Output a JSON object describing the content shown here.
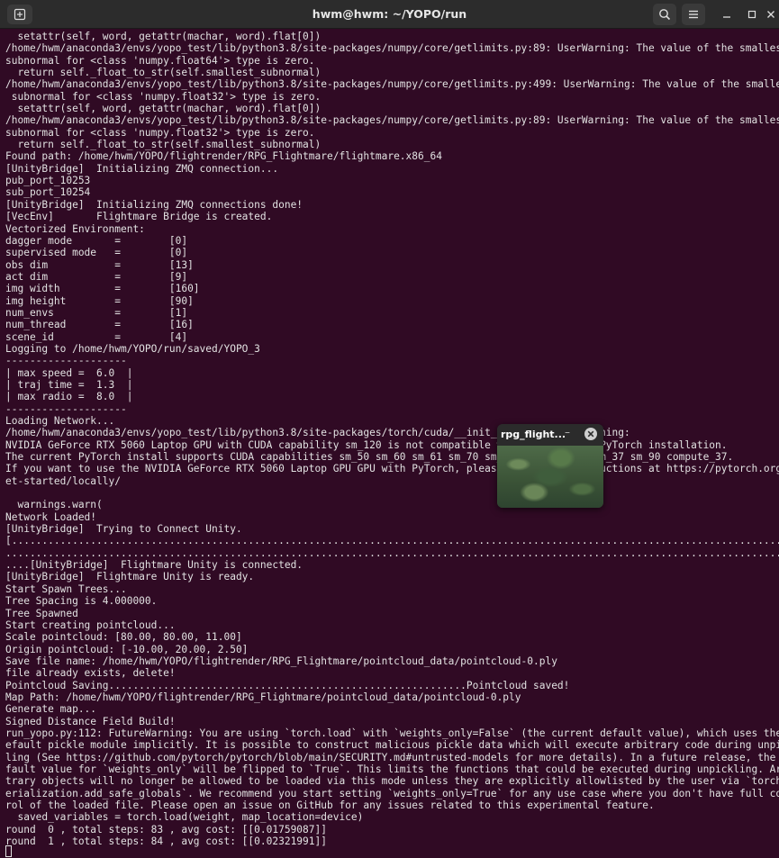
{
  "window": {
    "title": "hwm@hwm: ~/YOPO/run",
    "icons": {
      "new_tab": "new-tab-icon",
      "search": "search-icon",
      "menu": "hamburger-menu-icon",
      "minimize": "minimize-icon",
      "maximize": "maximize-icon",
      "close": "close-icon"
    }
  },
  "terminal": {
    "lines": [
      "  setattr(self, word, getattr(machar, word).flat[0])",
      "/home/hwm/anaconda3/envs/yopo_test/lib/python3.8/site-packages/numpy/core/getlimits.py:89: UserWarning: The value of the smallest",
      "subnormal for <class 'numpy.float64'> type is zero.",
      "  return self._float_to_str(self.smallest_subnormal)",
      "/home/hwm/anaconda3/envs/yopo_test/lib/python3.8/site-packages/numpy/core/getlimits.py:499: UserWarning: The value of the smalles",
      " subnormal for <class 'numpy.float32'> type is zero.",
      "  setattr(self, word, getattr(machar, word).flat[0])",
      "/home/hwm/anaconda3/envs/yopo_test/lib/python3.8/site-packages/numpy/core/getlimits.py:89: UserWarning: The value of the smallest",
      "subnormal for <class 'numpy.float32'> type is zero.",
      "  return self._float_to_str(self.smallest_subnormal)",
      "Found path: /home/hwm/YOPO/flightrender/RPG_Flightmare/flightmare.x86_64",
      "[UnityBridge]  Initializing ZMQ connection...",
      "pub_port_10253",
      "sub_port_10254",
      "[UnityBridge]  Initializing ZMQ connections done!",
      "[VecEnv]       Flightmare Bridge is created.",
      "Vectorized Environment:",
      "dagger mode       =        [0]",
      "supervised mode   =        [0]",
      "obs dim           =        [13]",
      "act dim           =        [9]",
      "img width         =        [160]",
      "img height        =        [90]",
      "num_envs          =        [1]",
      "num_thread        =        [16]",
      "scene_id          =        [4]",
      "Logging to /home/hwm/YOPO/run/saved/YOPO_3",
      "--------------------",
      "| max speed =  6.0  |",
      "| traj time =  1.3  |",
      "| max radio =  8.0  |",
      "--------------------",
      "Loading Network...",
      "/home/hwm/anaconda3/envs/yopo_test/lib/python3.8/site-packages/torch/cuda/__init__.py:230: UserWarning:",
      "NVIDIA GeForce RTX 5060 Laptop GPU with CUDA capability sm_120 is not compatible with the current PyTorch installation.",
      "The current PyTorch install supports CUDA capabilities sm_50 sm_60 sm_61 sm_70 sm_75 sm_80 sm_86 sm_37 sm_90 compute_37.",
      "If you want to use the NVIDIA GeForce RTX 5060 Laptop GPU GPU with PyTorch, please check the instructions at https://pytorch.org/g",
      "et-started/locally/",
      "",
      "  warnings.warn(",
      "Network Loaded!",
      "[UnityBridge]  Trying to Connect Unity.",
      "[..................................................................................................................................",
      "...................................................................................................................................",
      "....[UnityBridge]  Flightmare Unity is connected.",
      "[UnityBridge]  Flightmare Unity is ready.",
      "Start Spawn Trees...",
      "Tree Spacing is 4.000000.",
      "Tree Spawned",
      "Start creating pointcloud...",
      "Scale pointcloud: [80.00, 80.00, 11.00]",
      "Origin pointcloud: [-10.00, 20.00, 2.50]",
      "Save file name: /home/hwm/YOPO/flightrender/RPG_Flightmare/pointcloud_data/pointcloud-0.ply",
      "file already exists, delete!",
      "Pointcloud Saving...........................................................Pointcloud saved!",
      "Map Path: /home/hwm/YOPO/flightrender/RPG_Flightmare/pointcloud_data/pointcloud-0.ply",
      "Generate map...",
      "Signed Distance Field Build!",
      "run_yopo.py:112: FutureWarning: You are using `torch.load` with `weights_only=False` (the current default value), which uses the d",
      "efault pickle module implicitly. It is possible to construct malicious pickle data which will execute arbitrary code during unpick",
      "ling (See https://github.com/pytorch/pytorch/blob/main/SECURITY.md#untrusted-models for more details). In a future release, the de",
      "fault value for `weights_only` will be flipped to `True`. This limits the functions that could be executed during unpickling. Arbi",
      "trary objects will no longer be allowed to be loaded via this mode unless they are explicitly allowlisted by the user via `torch.s",
      "erialization.add_safe_globals`. We recommend you start setting `weights_only=True` for any use case where you don't have full cont",
      "rol of the loaded file. Please open an issue on GitHub for any issues related to this experimental feature.",
      "  saved_variables = torch.load(weight, map_location=device)",
      "round  0 , total steps: 83 , avg cost: [[0.01759087]]",
      "round  1 , total steps: 84 , avg cost: [[0.02321991]]"
    ]
  },
  "popup": {
    "title": "rpg_flight...",
    "minimize_glyph": "–",
    "icons": {
      "close": "close-circle-icon"
    }
  },
  "colors": {
    "terminal_bg": "#300a24",
    "titlebar_bg": "#2c2c2c",
    "text": "#e2e2e2"
  }
}
